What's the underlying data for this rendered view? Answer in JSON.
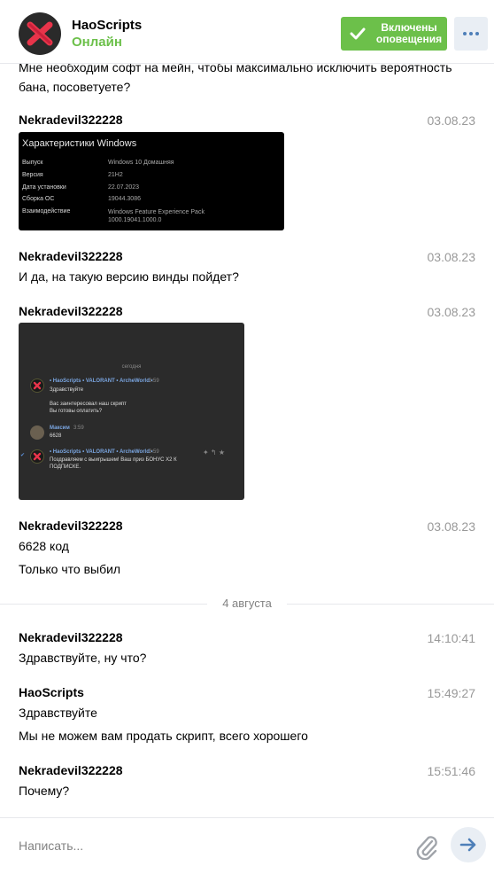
{
  "header": {
    "name": "HaoScripts",
    "status": "Онлайн",
    "notify_label_line1": "Включены",
    "notify_label_line2": "оповещения"
  },
  "messages": {
    "partial_text_1": "Мне необходим софт на мейн, чтобы максимально исключить вероятность",
    "partial_text_2": "бана, посоветуете?",
    "m1": {
      "author": "Nekradevil322228",
      "time": "03.08.23"
    },
    "m2": {
      "author": "Nekradevil322228",
      "time": "03.08.23",
      "text": "И да, на такую версию винды пойдет?"
    },
    "m3": {
      "author": "Nekradevil322228",
      "time": "03.08.23"
    },
    "m4": {
      "author": "Nekradevil322228",
      "time": "03.08.23",
      "text1": "6628 код",
      "text2": "Только что выбил"
    },
    "date_separator": "4 августа",
    "m5": {
      "author": "Nekradevil322228",
      "time": "14:10:41",
      "text": "Здравствуйте, ну что?"
    },
    "m6": {
      "author": "HaoScripts",
      "time": "15:49:27",
      "text1": "Здравствуйте",
      "text2": "Мы не можем вам продать скрипт, всего хорошего"
    },
    "m7": {
      "author": "Nekradevil322228",
      "time": "15:51:46",
      "text": "Почему?"
    }
  },
  "windows_screenshot": {
    "title": "Характеристики Windows",
    "rows": [
      {
        "label": "Выпуск",
        "value": "Windows 10 Домашняя"
      },
      {
        "label": "Версия",
        "value": "21H2"
      },
      {
        "label": "Дата установки",
        "value": "22.07.2023"
      },
      {
        "label": "Сборка ОС",
        "value": "19044.3086"
      },
      {
        "label": "Взаимодействие",
        "value": "Windows Feature Experience Pack",
        "value2": "1000.19041.1000.0"
      }
    ]
  },
  "chat_screenshot": {
    "day": "сегодня",
    "msg1_meta": "• HaoScripts • VALORANT • ArcheWorld •",
    "msg1_time": "3:59",
    "msg1_line1": "Здравствуйте",
    "msg1_line2": "Вас заинтересовал наш скрипт",
    "msg1_line3": "Вы готовы оплатить?",
    "msg2_name": "Максим",
    "msg2_time": "3:59",
    "msg2_text": "6628",
    "msg3_meta": "• HaoScripts • VALORANT • ArcheWorld •",
    "msg3_time": "3:59",
    "msg3_line1": "Поздравляем с выигрышем! Ваш приз БОНУС Х2 К",
    "msg3_line2": "ПОДПИСКЕ."
  },
  "composer": {
    "placeholder": "Написать..."
  },
  "colors": {
    "accent_green": "#6cc04a",
    "link_blue": "#4e7fb8",
    "muted": "#999999"
  },
  "icons": {
    "notify": "check-icon",
    "more": "more-dots-icon",
    "attach": "paperclip-icon",
    "send": "send-arrow-icon"
  }
}
